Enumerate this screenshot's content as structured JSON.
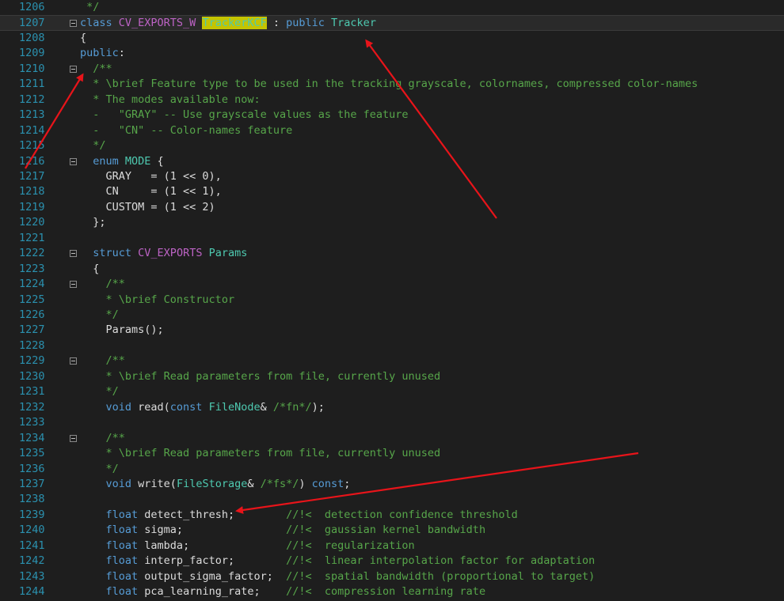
{
  "lines": [
    {
      "num": "1206",
      "fold": false,
      "indent": "",
      "tokens": [
        {
          "t": " */",
          "c": "cm"
        }
      ]
    },
    {
      "num": "1207",
      "fold": true,
      "current": true,
      "indent": "",
      "tokens": [
        {
          "t": "class ",
          "c": "kw"
        },
        {
          "t": "CV_EXPORTS_W",
          "c": "mac"
        },
        {
          "t": " ",
          "c": ""
        },
        {
          "t": "TrackerKCF",
          "c": "hl"
        },
        {
          "t": " : ",
          "c": ""
        },
        {
          "t": "public ",
          "c": "kw"
        },
        {
          "t": "Tracker",
          "c": "ty"
        }
      ]
    },
    {
      "num": "1208",
      "fold": false,
      "indent": "",
      "tokens": [
        {
          "t": "{",
          "c": ""
        }
      ]
    },
    {
      "num": "1209",
      "fold": false,
      "indent": "",
      "tokens": [
        {
          "t": "public",
          "c": "kw"
        },
        {
          "t": ":",
          "c": ""
        }
      ]
    },
    {
      "num": "1210",
      "fold": true,
      "indent": "  ",
      "tokens": [
        {
          "t": "/**",
          "c": "cm"
        }
      ]
    },
    {
      "num": "1211",
      "fold": false,
      "indent": "  ",
      "tokens": [
        {
          "t": "* \\brief Feature type to be used in the tracking grayscale, colornames, compressed color-names",
          "c": "cm"
        }
      ]
    },
    {
      "num": "1212",
      "fold": false,
      "indent": "  ",
      "tokens": [
        {
          "t": "* The modes available now:",
          "c": "cm"
        }
      ]
    },
    {
      "num": "1213",
      "fold": false,
      "indent": "  ",
      "tokens": [
        {
          "t": "-   \"GRAY\" -- Use grayscale values as the feature",
          "c": "cm"
        }
      ]
    },
    {
      "num": "1214",
      "fold": false,
      "indent": "  ",
      "tokens": [
        {
          "t": "-   \"CN\" -- Color-names feature",
          "c": "cm"
        }
      ]
    },
    {
      "num": "1215",
      "fold": false,
      "indent": "  ",
      "tokens": [
        {
          "t": "*/",
          "c": "cm"
        }
      ]
    },
    {
      "num": "1216",
      "fold": true,
      "indent": "  ",
      "tokens": [
        {
          "t": "enum ",
          "c": "kw"
        },
        {
          "t": "MODE",
          "c": "ty"
        },
        {
          "t": " {",
          "c": ""
        }
      ]
    },
    {
      "num": "1217",
      "fold": false,
      "indent": "    ",
      "tokens": [
        {
          "t": "GRAY   = (1 << 0),",
          "c": ""
        }
      ]
    },
    {
      "num": "1218",
      "fold": false,
      "indent": "    ",
      "tokens": [
        {
          "t": "CN     = (1 << 1),",
          "c": ""
        }
      ]
    },
    {
      "num": "1219",
      "fold": false,
      "indent": "    ",
      "tokens": [
        {
          "t": "CUSTOM = (1 << 2)",
          "c": ""
        }
      ]
    },
    {
      "num": "1220",
      "fold": false,
      "indent": "  ",
      "tokens": [
        {
          "t": "};",
          "c": ""
        }
      ]
    },
    {
      "num": "1221",
      "fold": false,
      "indent": "",
      "tokens": []
    },
    {
      "num": "1222",
      "fold": true,
      "indent": "  ",
      "tokens": [
        {
          "t": "struct ",
          "c": "kw"
        },
        {
          "t": "CV_EXPORTS",
          "c": "mac"
        },
        {
          "t": " ",
          "c": ""
        },
        {
          "t": "Params",
          "c": "ty"
        }
      ]
    },
    {
      "num": "1223",
      "fold": false,
      "indent": "  ",
      "tokens": [
        {
          "t": "{",
          "c": ""
        }
      ]
    },
    {
      "num": "1224",
      "fold": true,
      "indent": "    ",
      "tokens": [
        {
          "t": "/**",
          "c": "cm"
        }
      ]
    },
    {
      "num": "1225",
      "fold": false,
      "indent": "    ",
      "tokens": [
        {
          "t": "* \\brief Constructor",
          "c": "cm"
        }
      ]
    },
    {
      "num": "1226",
      "fold": false,
      "indent": "    ",
      "tokens": [
        {
          "t": "*/",
          "c": "cm"
        }
      ]
    },
    {
      "num": "1227",
      "fold": false,
      "indent": "    ",
      "tokens": [
        {
          "t": "Params();",
          "c": ""
        }
      ]
    },
    {
      "num": "1228",
      "fold": false,
      "indent": "",
      "tokens": []
    },
    {
      "num": "1229",
      "fold": true,
      "indent": "    ",
      "tokens": [
        {
          "t": "/**",
          "c": "cm"
        }
      ]
    },
    {
      "num": "1230",
      "fold": false,
      "indent": "    ",
      "tokens": [
        {
          "t": "* \\brief Read parameters from file, currently unused",
          "c": "cm"
        }
      ]
    },
    {
      "num": "1231",
      "fold": false,
      "indent": "    ",
      "tokens": [
        {
          "t": "*/",
          "c": "cm"
        }
      ]
    },
    {
      "num": "1232",
      "fold": false,
      "indent": "    ",
      "tokens": [
        {
          "t": "void ",
          "c": "kw"
        },
        {
          "t": "read(",
          "c": ""
        },
        {
          "t": "const ",
          "c": "kw"
        },
        {
          "t": "FileNode",
          "c": "ty"
        },
        {
          "t": "& ",
          "c": ""
        },
        {
          "t": "/*fn*/",
          "c": "cm"
        },
        {
          "t": ");",
          "c": ""
        }
      ]
    },
    {
      "num": "1233",
      "fold": false,
      "indent": "",
      "tokens": []
    },
    {
      "num": "1234",
      "fold": true,
      "indent": "    ",
      "tokens": [
        {
          "t": "/**",
          "c": "cm"
        }
      ]
    },
    {
      "num": "1235",
      "fold": false,
      "indent": "    ",
      "tokens": [
        {
          "t": "* \\brief Read parameters from file, currently unused",
          "c": "cm"
        }
      ]
    },
    {
      "num": "1236",
      "fold": false,
      "indent": "    ",
      "tokens": [
        {
          "t": "*/",
          "c": "cm"
        }
      ]
    },
    {
      "num": "1237",
      "fold": false,
      "indent": "    ",
      "tokens": [
        {
          "t": "void ",
          "c": "kw"
        },
        {
          "t": "write(",
          "c": ""
        },
        {
          "t": "FileStorage",
          "c": "ty"
        },
        {
          "t": "& ",
          "c": ""
        },
        {
          "t": "/*fs*/",
          "c": "cm"
        },
        {
          "t": ") ",
          "c": ""
        },
        {
          "t": "const",
          "c": "kw"
        },
        {
          "t": ";",
          "c": ""
        }
      ]
    },
    {
      "num": "1238",
      "fold": false,
      "indent": "",
      "tokens": []
    },
    {
      "num": "1239",
      "fold": false,
      "indent": "    ",
      "tokens": [
        {
          "t": "float ",
          "c": "kw"
        },
        {
          "t": "detect_thresh;        ",
          "c": ""
        },
        {
          "t": "//!<  detection confidence threshold",
          "c": "cm"
        }
      ]
    },
    {
      "num": "1240",
      "fold": false,
      "indent": "    ",
      "tokens": [
        {
          "t": "float ",
          "c": "kw"
        },
        {
          "t": "sigma;                ",
          "c": ""
        },
        {
          "t": "//!<  gaussian kernel bandwidth",
          "c": "cm"
        }
      ]
    },
    {
      "num": "1241",
      "fold": false,
      "indent": "    ",
      "tokens": [
        {
          "t": "float ",
          "c": "kw"
        },
        {
          "t": "lambda;               ",
          "c": ""
        },
        {
          "t": "//!<  regularization",
          "c": "cm"
        }
      ]
    },
    {
      "num": "1242",
      "fold": false,
      "indent": "    ",
      "tokens": [
        {
          "t": "float ",
          "c": "kw"
        },
        {
          "t": "interp_factor;        ",
          "c": ""
        },
        {
          "t": "//!<  linear interpolation factor for adaptation",
          "c": "cm"
        }
      ]
    },
    {
      "num": "1243",
      "fold": false,
      "indent": "    ",
      "tokens": [
        {
          "t": "float ",
          "c": "kw"
        },
        {
          "t": "output_sigma_factor;  ",
          "c": ""
        },
        {
          "t": "//!<  spatial bandwidth (proportional to target)",
          "c": "cm"
        }
      ]
    },
    {
      "num": "1244",
      "fold": false,
      "indent": "    ",
      "tokens": [
        {
          "t": "float ",
          "c": "kw"
        },
        {
          "t": "pca_learning_rate;    ",
          "c": ""
        },
        {
          "t": "//!<  compression learning rate",
          "c": "cm"
        }
      ]
    }
  ],
  "colors": {
    "annotation_arrow": "#e8141a",
    "keyword": "#569cd6",
    "comment": "#57a64a",
    "type": "#4ec9b0",
    "macro": "#bd63c5",
    "line_number": "#2b91af",
    "highlight": "#c4c400"
  }
}
